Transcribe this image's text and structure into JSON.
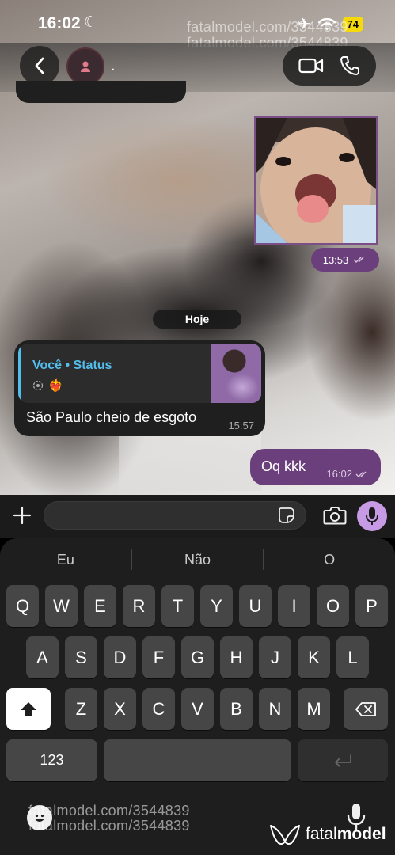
{
  "status_bar": {
    "time": "16:02",
    "moon_icon": "moon-icon",
    "airplane_icon": "airplane-icon",
    "wifi_icon": "wifi-icon",
    "battery": "74",
    "battery_color": "#f5d90a"
  },
  "header": {
    "back_icon": "chevron-left-icon",
    "contact_name": ".",
    "video_icon": "video-camera-icon",
    "call_icon": "phone-icon"
  },
  "messages": {
    "media_time": "13:53",
    "date_divider": "Hoje",
    "reply": {
      "quote_title": "Você • Status",
      "quote_emoji": "❤️‍🔥",
      "text": "São Paulo cheio de esgoto",
      "time": "15:57"
    },
    "outgoing": {
      "text": "Oq kkk",
      "time": "16:02"
    }
  },
  "input_bar": {
    "value": ""
  },
  "keyboard": {
    "suggestions": [
      "Eu",
      "Não",
      "O"
    ],
    "row1": [
      "Q",
      "W",
      "E",
      "R",
      "T",
      "Y",
      "U",
      "I",
      "O",
      "P"
    ],
    "row2": [
      "A",
      "S",
      "D",
      "F",
      "G",
      "H",
      "J",
      "K",
      "L"
    ],
    "row3": [
      "Z",
      "X",
      "C",
      "V",
      "B",
      "N",
      "M"
    ],
    "numbers_key": "123",
    "shift_icon": "shift-icon",
    "backspace_icon": "backspace-icon",
    "return_icon": "return-icon"
  },
  "watermark": {
    "text": "fatalmodel.com/3544839",
    "brand_light": "fatal",
    "brand_bold": "model"
  },
  "colors": {
    "outgoing_bubble": "#6b3f7c",
    "incoming_bubble": "#1f1f1f",
    "quote_accent": "#53bdeb",
    "mic_button": "#c79ae6"
  }
}
